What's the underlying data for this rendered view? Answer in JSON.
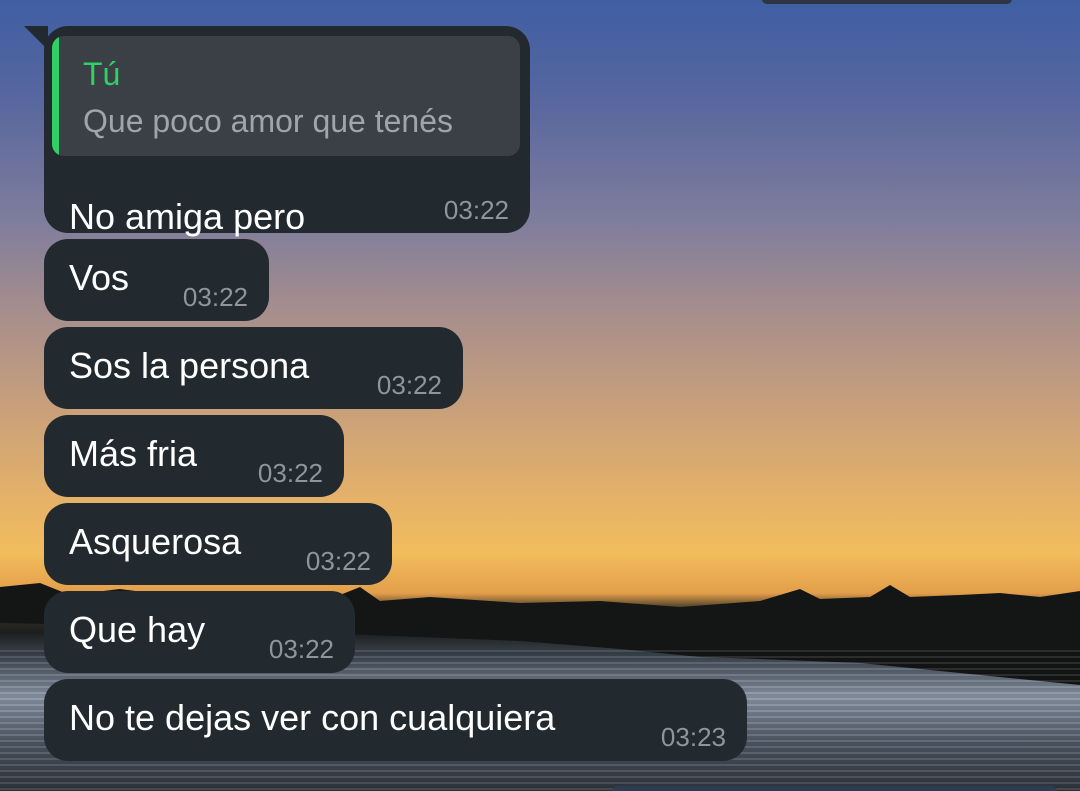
{
  "colors": {
    "bubble_bg": "#222a30",
    "reply_bg": "#3a4045",
    "reply_accent": "#2fd166",
    "timestamp": "#8d969d",
    "text": "#ffffff"
  },
  "reply": {
    "author": "Tú",
    "quoted_text": "Que poco amor que tenés"
  },
  "messages": [
    {
      "text": "No amiga pero",
      "time": "03:22"
    },
    {
      "text": "Vos",
      "time": "03:22"
    },
    {
      "text": "Sos la persona",
      "time": "03:22"
    },
    {
      "text": "Más fria",
      "time": "03:22"
    },
    {
      "text": "Asquerosa",
      "time": "03:22"
    },
    {
      "text": "Que hay",
      "time": "03:22"
    },
    {
      "text": "No te dejas ver con cualquiera",
      "time": "03:23"
    }
  ]
}
